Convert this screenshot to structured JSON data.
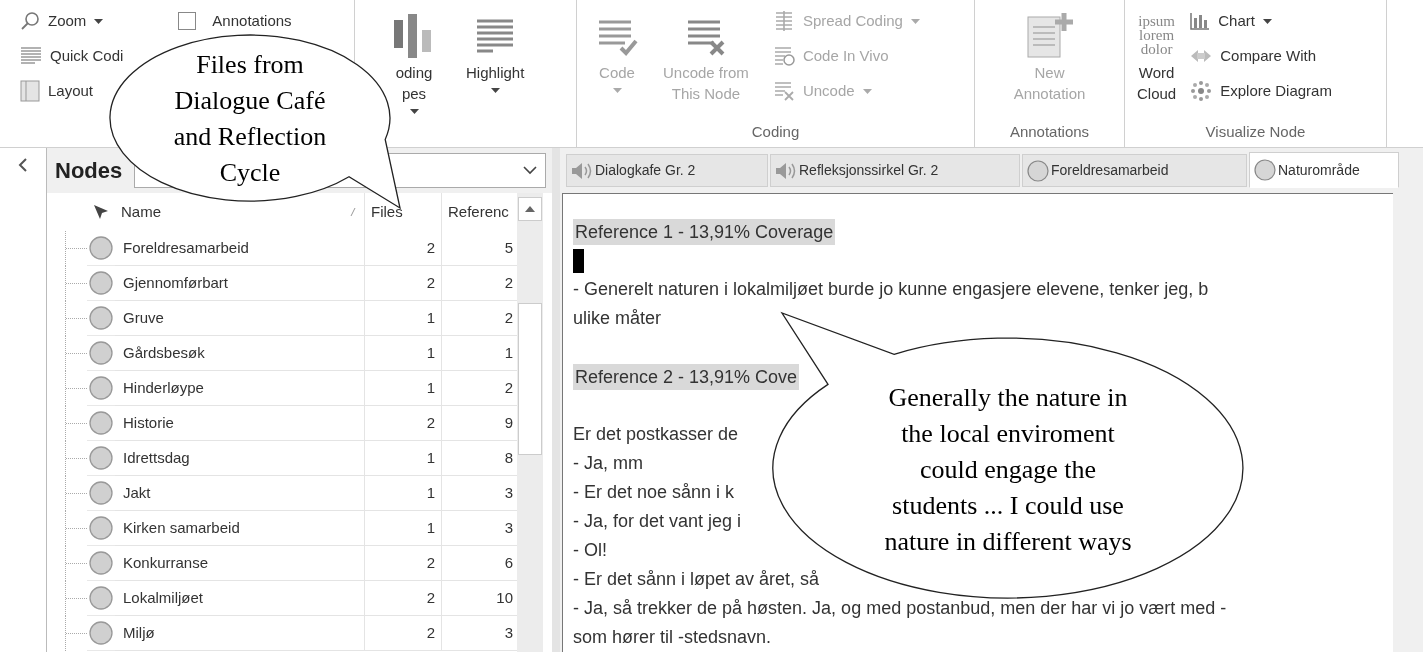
{
  "ribbon_groups": [
    {
      "items": [
        {
          "kind": "small",
          "label": "Zoom",
          "dropdown": true,
          "disabled": false
        },
        {
          "kind": "small",
          "label": "Quick Codi",
          "dropdown": false,
          "disabled": false
        },
        {
          "kind": "small",
          "label": "Layout",
          "dropdown": false,
          "disabled": false
        },
        {
          "kind": "checkbox",
          "label": "Annotations",
          "checked": false,
          "disabled": false
        }
      ]
    },
    {
      "items": [
        {
          "kind": "large",
          "label": "oding",
          "label_2": "pes",
          "dropdown": true,
          "disabled": false
        },
        {
          "kind": "large",
          "label": "Highlight",
          "dropdown": true,
          "disabled": false
        }
      ]
    },
    {
      "title": "Coding",
      "items": [
        {
          "kind": "large",
          "label": "Code",
          "dropdown": true,
          "disabled": true
        },
        {
          "kind": "large",
          "label": "Uncode from",
          "label_2": "This Node",
          "dropdown": false,
          "disabled": true
        },
        {
          "kind": "small",
          "label": "Spread Coding",
          "dropdown": true,
          "disabled": true
        },
        {
          "kind": "small",
          "label": "Code In Vivo",
          "dropdown": false,
          "disabled": true
        },
        {
          "kind": "small",
          "label": "Uncode",
          "dropdown": true,
          "disabled": true
        }
      ]
    },
    {
      "title": "Annotations",
      "items": [
        {
          "kind": "large",
          "label": "New",
          "label_2": "Annotation",
          "dropdown": false,
          "disabled": true
        }
      ]
    },
    {
      "title": "Visualize Node",
      "items": [
        {
          "kind": "large",
          "label": "Word",
          "label_2": "Cloud",
          "icon_text": [
            "ipsum",
            "lorem",
            "dolor"
          ],
          "dropdown": false,
          "disabled": false
        },
        {
          "kind": "small",
          "label": "Chart",
          "dropdown": true,
          "disabled": false
        },
        {
          "kind": "small",
          "label": "Compare With",
          "dropdown": false,
          "disabled": false
        },
        {
          "kind": "small",
          "label": "Explore Diagram",
          "dropdown": false,
          "disabled": false
        }
      ]
    }
  ],
  "nodes_panel": {
    "title": "Nodes",
    "columns": [
      "Name",
      "Files",
      "Referenc"
    ],
    "rows": [
      {
        "name": "Foreldresamarbeid",
        "files": "2",
        "references": "5"
      },
      {
        "name": "Gjennomførbart",
        "files": "2",
        "references": "2"
      },
      {
        "name": "Gruve",
        "files": "1",
        "references": "2"
      },
      {
        "name": "Gårdsbesøk",
        "files": "1",
        "references": "1"
      },
      {
        "name": "Hinderløype",
        "files": "1",
        "references": "2"
      },
      {
        "name": "Historie",
        "files": "2",
        "references": "9"
      },
      {
        "name": "Idrettsdag",
        "files": "1",
        "references": "8"
      },
      {
        "name": "Jakt",
        "files": "1",
        "references": "3"
      },
      {
        "name": "Kirken samarbeid",
        "files": "1",
        "references": "3"
      },
      {
        "name": "Konkurranse",
        "files": "2",
        "references": "6"
      },
      {
        "name": "Lokalmiljøet",
        "files": "2",
        "references": "10"
      },
      {
        "name": "Miljø",
        "files": "2",
        "references": "3"
      }
    ]
  },
  "tabs": [
    {
      "label": "Dialogkafe Gr. 2",
      "kind": "audio",
      "selected": false
    },
    {
      "label": "Refleksjonssirkel Gr. 2",
      "kind": "audio",
      "selected": false
    },
    {
      "label": "Foreldresamarbeid",
      "kind": "node",
      "selected": false
    },
    {
      "label": "Naturområde",
      "kind": "node",
      "selected": true
    }
  ],
  "document": [
    {
      "kind": "heading",
      "text": "Reference 1 - 13,91% Coverage"
    },
    {
      "kind": "cursor"
    },
    {
      "kind": "text",
      "text": "- Generelt naturen i lokalmiljøet burde jo kunne engasjere elevene, tenker jeg, b"
    },
    {
      "kind": "text",
      "text": "ulike måter"
    },
    {
      "kind": "blank"
    },
    {
      "kind": "heading",
      "text": "Reference 2 - 13,91% Cove"
    },
    {
      "kind": "blank"
    },
    {
      "kind": "text",
      "text": "Er det postkasser de"
    },
    {
      "kind": "text",
      "text": "- Ja, mm"
    },
    {
      "kind": "text",
      "text": "- Er det noe sånn i k"
    },
    {
      "kind": "text",
      "text": "- Ja, for det vant jeg i"
    },
    {
      "kind": "text",
      "text": "- Ol!"
    },
    {
      "kind": "text",
      "text": "- Er det sånn i løpet av året, så"
    },
    {
      "kind": "text",
      "text": "- Ja, så trekker de på høsten. Ja, og med postanbud, men der har vi jo vært med -"
    },
    {
      "kind": "text",
      "text": "som hører til -stedsnavn."
    }
  ],
  "callouts": [
    {
      "lines": [
        "Files from",
        "Dialogue Café",
        "and Reflection",
        "Cycle"
      ]
    },
    {
      "lines": [
        "Generally the nature in",
        "the local enviroment",
        "could engage the",
        "students ... I could use",
        "nature in different ways"
      ]
    }
  ]
}
